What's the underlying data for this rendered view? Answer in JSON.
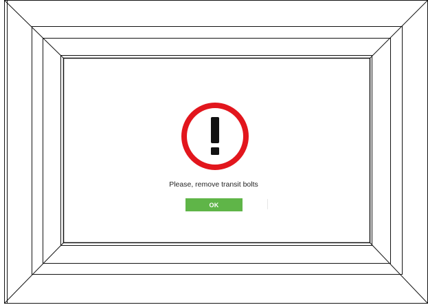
{
  "dialog": {
    "message": "Please, remove transit bolts",
    "ok_label": "OK",
    "icon": "exclamation-icon"
  },
  "colors": {
    "alert_ring": "#e2161d",
    "ok_button": "#5fb548"
  }
}
